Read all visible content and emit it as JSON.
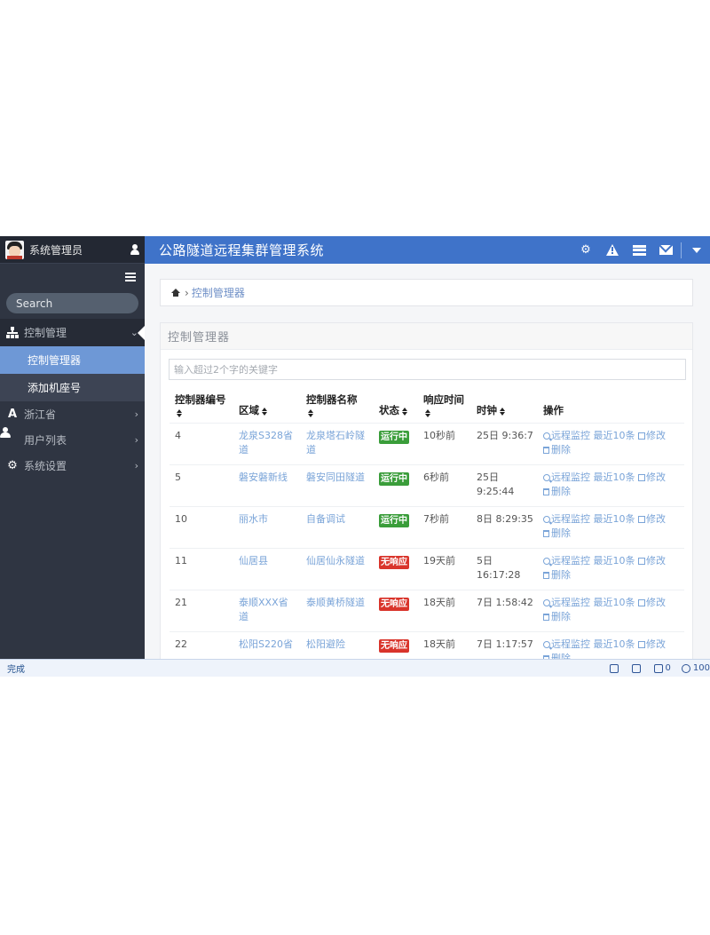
{
  "sidebar": {
    "user_name": "系统管理员",
    "search_placeholder": "Search",
    "menu": [
      {
        "label": "控制管理",
        "icon": "sitemap-icon",
        "expanded": true,
        "children": [
          {
            "label": "控制管理器",
            "active": true
          },
          {
            "label": "添加机座号",
            "active": false
          }
        ]
      },
      {
        "label": "浙江省",
        "icon": "road-icon",
        "expanded": false
      },
      {
        "label": "用户列表",
        "icon": "user-icon",
        "expanded": false
      },
      {
        "label": "系统设置",
        "icon": "gear-icon",
        "expanded": false
      }
    ]
  },
  "topbar": {
    "title": "公路隧道远程集群管理系统",
    "icons": [
      "gear-icon",
      "warning-icon",
      "server-icon",
      "mail-icon",
      "caret-down-icon"
    ]
  },
  "breadcrumb": {
    "current": "控制管理器"
  },
  "panel": {
    "title": "控制管理器",
    "search_placeholder": "输入超过2个字的关键字",
    "columns": [
      "控制器编号",
      "区域",
      "控制器名称",
      "状态",
      "响应时间",
      "时钟",
      "操作"
    ],
    "actions": {
      "monitor": "远程监控",
      "recent": "最近10条",
      "edit": "修改",
      "delete": "删除"
    },
    "rows": [
      {
        "id": "4",
        "region": "龙泉S328省道",
        "name": "龙泉塔石岭隧道",
        "status": "运行中",
        "response": "10秒前",
        "clock": "25日 9:36:7"
      },
      {
        "id": "5",
        "region": "磐安磐新线",
        "name": "磐安同田隧道",
        "status": "运行中",
        "response": "6秒前",
        "clock": "25日 9:25:44"
      },
      {
        "id": "10",
        "region": "丽水市",
        "name": "自备调试",
        "status": "运行中",
        "response": "7秒前",
        "clock": "8日 8:29:35"
      },
      {
        "id": "11",
        "region": "仙居县",
        "name": "仙居仙永隧道",
        "status": "无响应",
        "response": "19天前",
        "clock": "5日 16:17:28"
      },
      {
        "id": "21",
        "region": "泰顺XXX省道",
        "name": "泰顺黄桥隧道",
        "status": "无响应",
        "response": "18天前",
        "clock": "7日 1:58:42"
      },
      {
        "id": "22",
        "region": "松阳S220省",
        "name": "松阳避险",
        "status": "无响应",
        "response": "18天前",
        "clock": "7日 1:17:57"
      }
    ]
  },
  "status_colors": {
    "运行中": "#3a9d3a",
    "无响应": "#d9342b"
  },
  "statusbar": {
    "text": "完成",
    "count": "0",
    "zoom": "100"
  }
}
